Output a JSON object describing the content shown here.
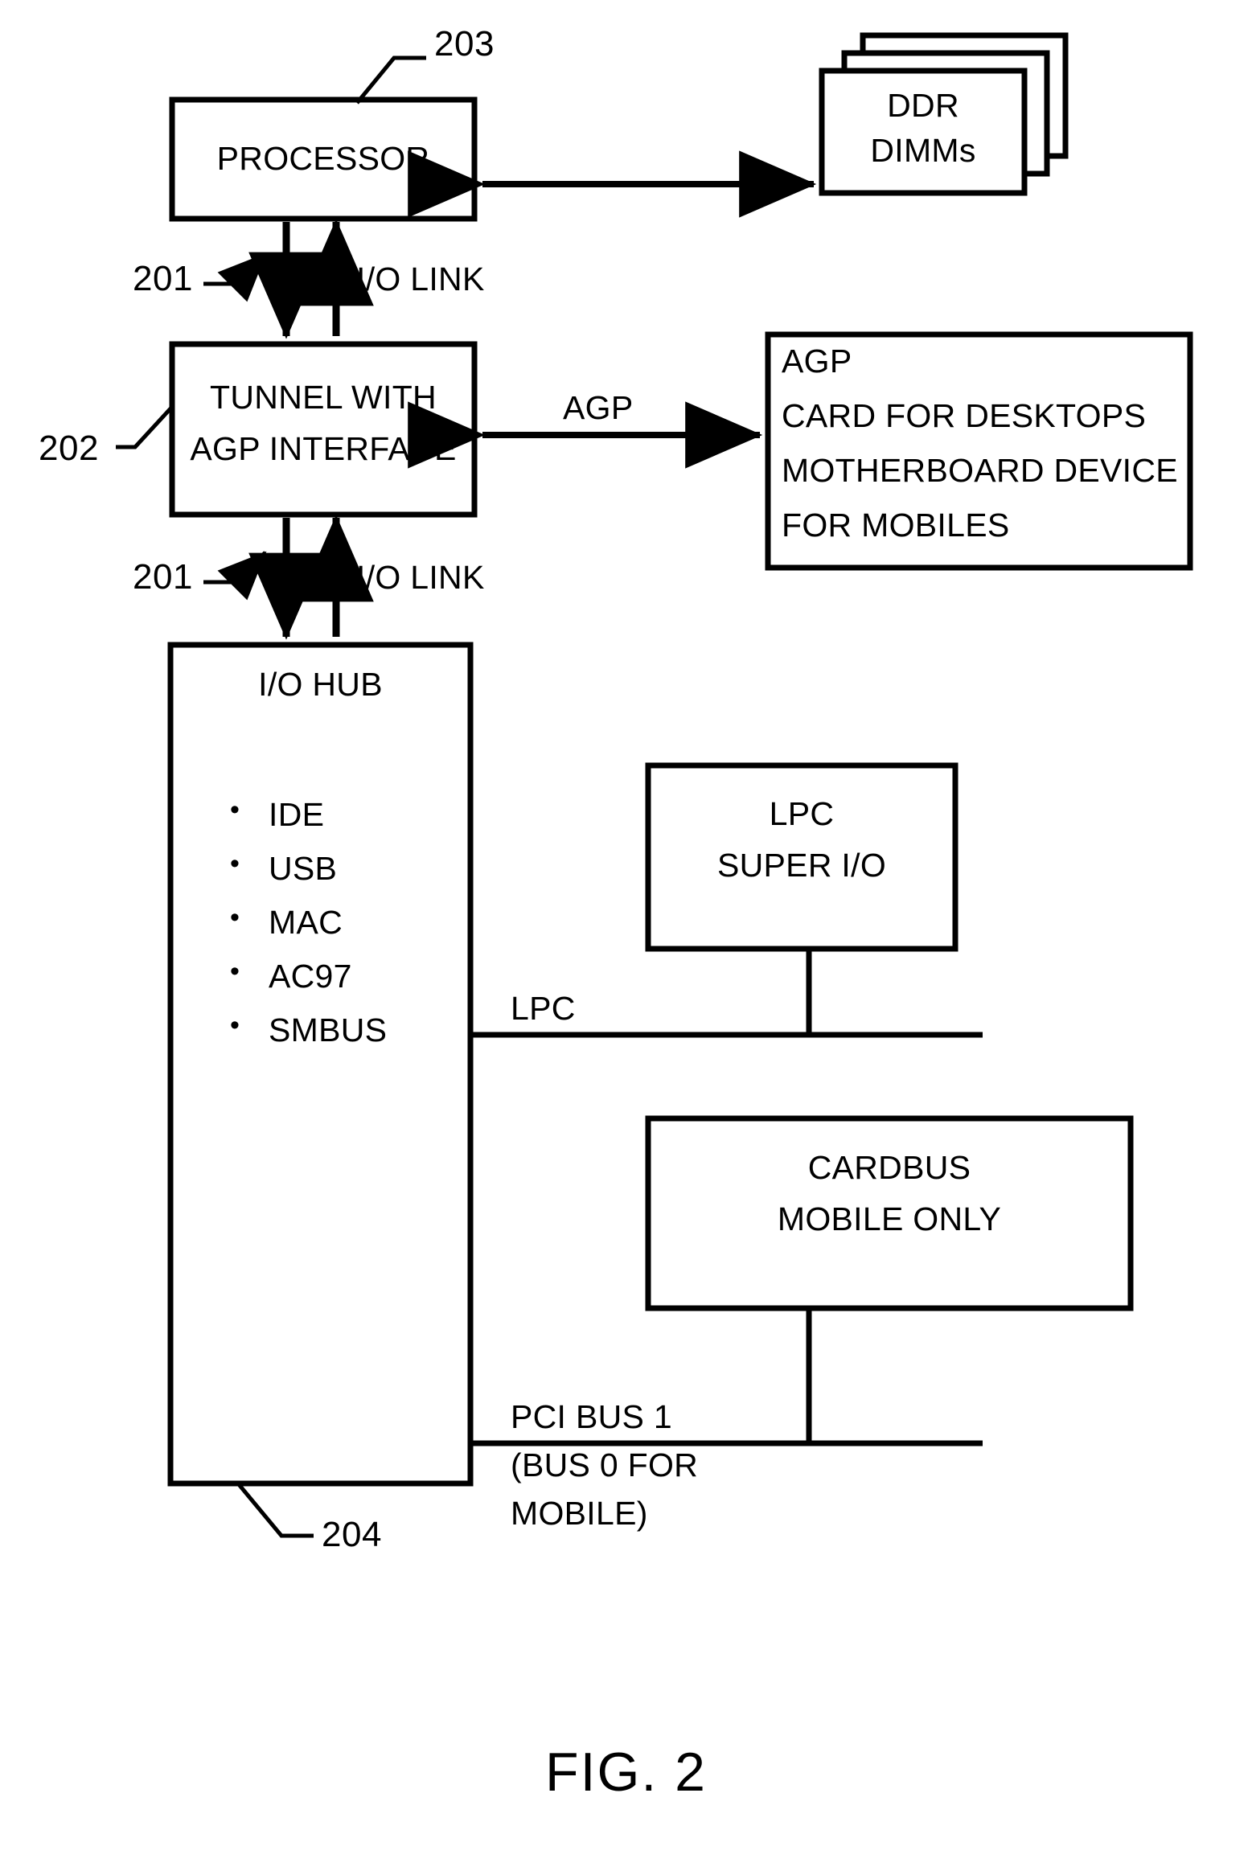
{
  "figure": {
    "caption": "FIG. 2",
    "reference_numerals": {
      "processor": "203",
      "io_link_upper": "201",
      "tunnel": "202",
      "io_link_lower": "201",
      "io_hub": "204"
    }
  },
  "blocks": {
    "processor": {
      "label": "PROCESSOR"
    },
    "ddr_dimms": {
      "line1": "DDR",
      "line2": "DIMMs"
    },
    "tunnel": {
      "line1": "TUNNEL WITH",
      "line2": "AGP INTERFACE"
    },
    "agp_device": {
      "line1": "AGP",
      "line2": "CARD FOR DESKTOPS",
      "line3": "MOTHERBOARD DEVICE",
      "line4": "FOR MOBILES"
    },
    "io_hub": {
      "title": "I/O HUB",
      "features": [
        "IDE",
        "USB",
        "MAC",
        "AC97",
        "SMBUS"
      ]
    },
    "lpc_super_io": {
      "line1": "LPC",
      "line2": "SUPER I/O"
    },
    "cardbus": {
      "line1": "CARDBUS",
      "line2": "MOBILE ONLY"
    }
  },
  "connections": {
    "io_link_upper_label": "I/O LINK",
    "io_link_lower_label": "I/O LINK",
    "agp_label": "AGP",
    "lpc_bus_label": "LPC",
    "pci_bus_label_line1": "PCI BUS 1",
    "pci_bus_label_line2": "(BUS 0 FOR",
    "pci_bus_label_line3": "MOBILE)"
  },
  "colors": {
    "stroke": "#000000",
    "background": "#ffffff"
  }
}
